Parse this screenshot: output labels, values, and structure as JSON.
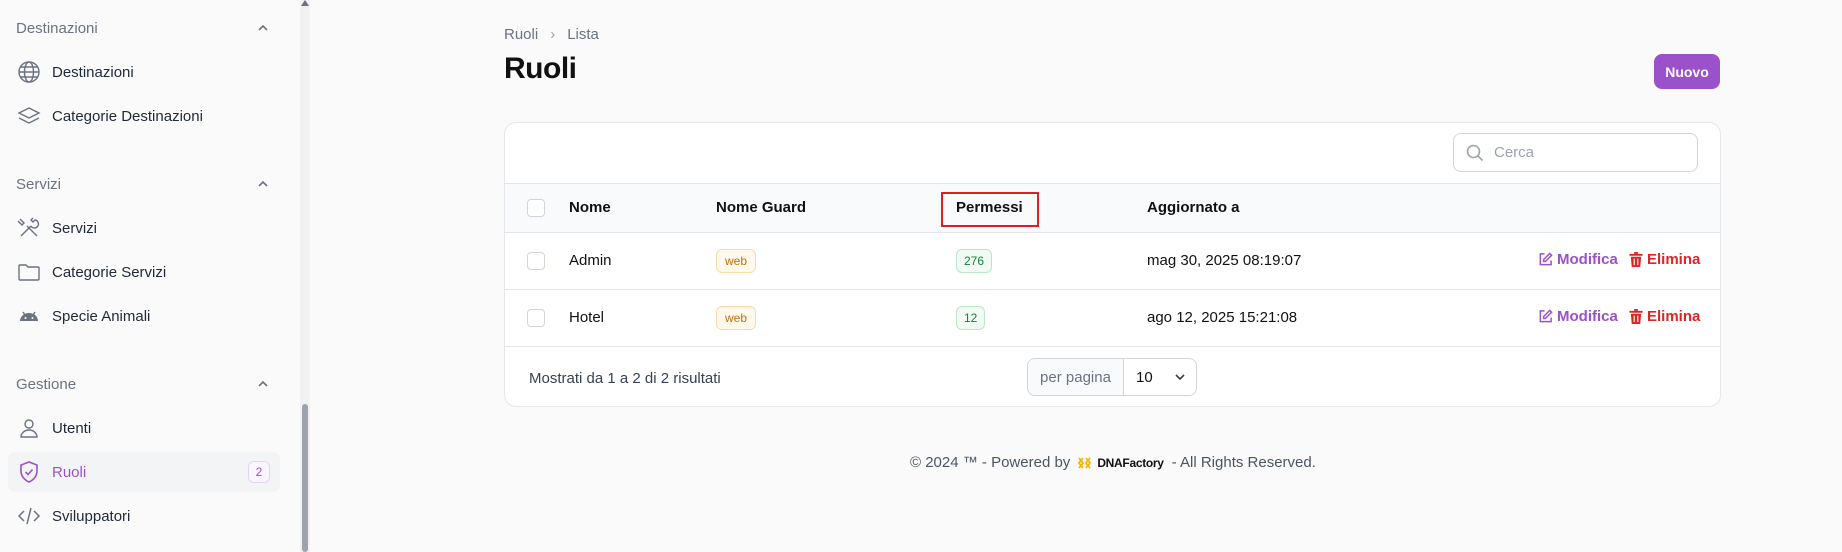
{
  "sidebar": {
    "groups": [
      {
        "label": "Destinazioni",
        "items": [
          {
            "label": "Destinazioni",
            "icon": "globe-icon"
          },
          {
            "label": "Categorie Destinazioni",
            "icon": "layers-icon"
          }
        ]
      },
      {
        "label": "Servizi",
        "items": [
          {
            "label": "Servizi",
            "icon": "tools-icon"
          },
          {
            "label": "Categorie Servizi",
            "icon": "folder-icon"
          },
          {
            "label": "Specie Animali",
            "icon": "android-icon"
          }
        ]
      },
      {
        "label": "Gestione",
        "items": [
          {
            "label": "Utenti",
            "icon": "user-icon"
          },
          {
            "label": "Ruoli",
            "icon": "shield-check-icon",
            "badge": "2",
            "active": true
          },
          {
            "label": "Sviluppatori",
            "icon": "code-icon"
          }
        ]
      }
    ]
  },
  "breadcrumb": {
    "parent": "Ruoli",
    "current": "Lista"
  },
  "page": {
    "title": "Ruoli",
    "new_button": "Nuovo"
  },
  "search": {
    "placeholder": "Cerca",
    "value": ""
  },
  "table": {
    "columns": [
      "Nome",
      "Nome Guard",
      "Permessi",
      "Aggiornato a"
    ],
    "rows": [
      {
        "nome": "Admin",
        "guard": "web",
        "permessi": "276",
        "aggiornato": "mag 30, 2025 08:19:07"
      },
      {
        "nome": "Hotel",
        "guard": "web",
        "permessi": "12",
        "aggiornato": "ago 12, 2025 15:21:08"
      }
    ],
    "actions": {
      "edit": "Modifica",
      "delete": "Elimina"
    }
  },
  "pagination": {
    "summary": "Mostrati da 1 a 2 di 2 risultati",
    "per_page_label": "per pagina",
    "per_page_value": "10"
  },
  "footer": {
    "prefix": "© 2024 ™ - Powered by",
    "brand": "DNAFactory",
    "suffix": "- All Rights Reserved."
  },
  "colors": {
    "accent": "#9b51c9",
    "danger": "#dc2626",
    "highlight": "#e11d24"
  }
}
